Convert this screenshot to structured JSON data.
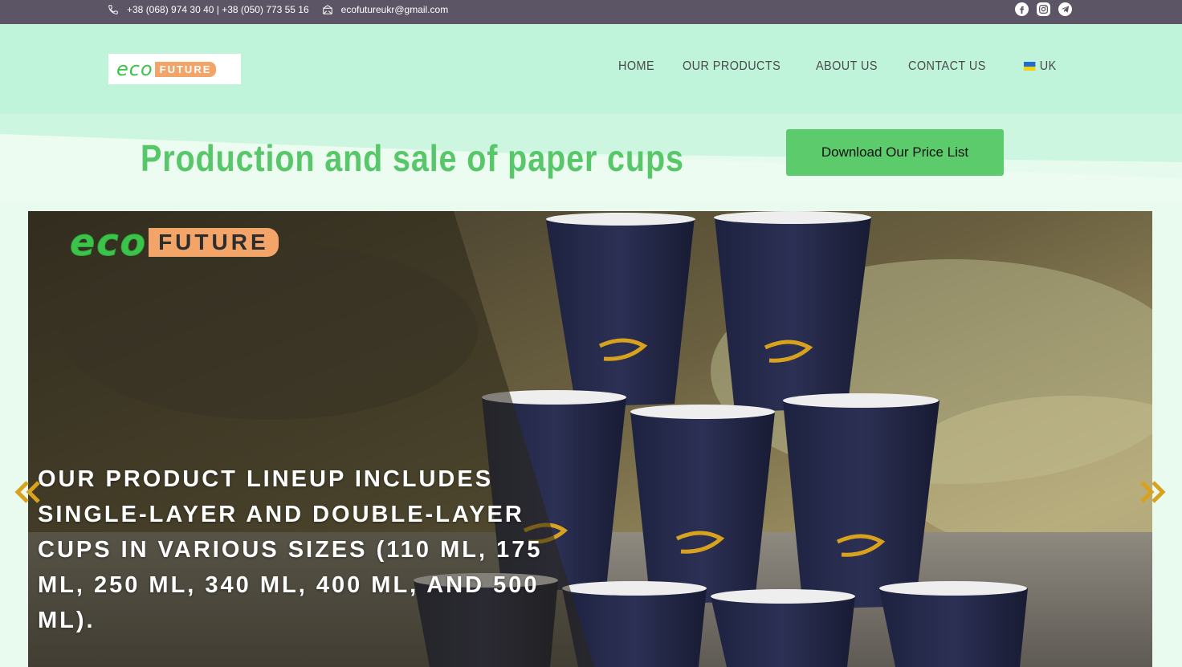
{
  "topbar": {
    "phones": "+38 (068) 974 30 40 | +38 (050) 773 55 16",
    "email": "ecofutureukr@gmail.com",
    "social": [
      "facebook-icon",
      "instagram-icon",
      "telegram-icon"
    ]
  },
  "header": {
    "logo_eco": "eco",
    "logo_future": "FUTURE",
    "nav": [
      "HOME",
      "OUR PRODUCTS",
      "ABOUT US",
      "CONTACT US"
    ],
    "language": "UK"
  },
  "banner": {
    "headline": "Production and sale of paper cups",
    "price_button": "Download Our Price List"
  },
  "hero": {
    "logo_eco": "eco",
    "logo_future": "FUTURE",
    "text": "Our product lineup includes single-layer and double-layer cups in various sizes (110 ml, 175 ml, 250 ml, 340 ml, 400 ml, and 500 ml)."
  },
  "colors": {
    "topbar": "#5b5566",
    "header": "#bff3da",
    "accent_green": "#58c76a",
    "logo_orange": "#f3a468",
    "arrow_gold": "#d9a21e"
  }
}
